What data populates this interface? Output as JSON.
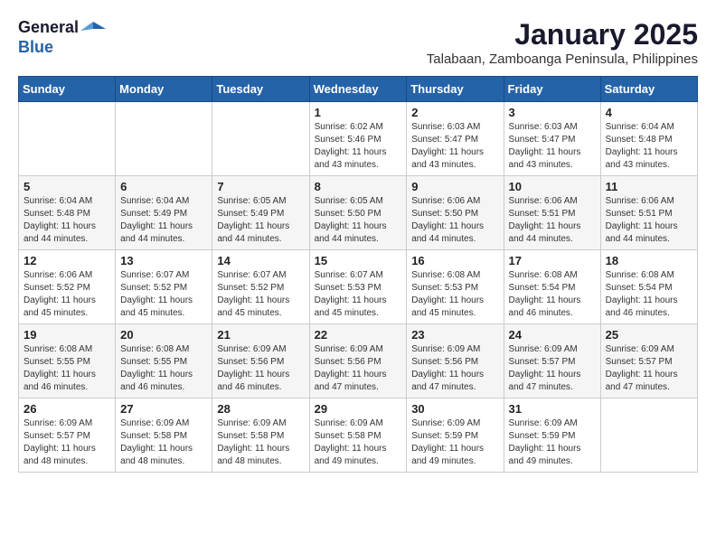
{
  "header": {
    "logo_general": "General",
    "logo_blue": "Blue",
    "month": "January 2025",
    "location": "Talabaan, Zamboanga Peninsula, Philippines"
  },
  "weekdays": [
    "Sunday",
    "Monday",
    "Tuesday",
    "Wednesday",
    "Thursday",
    "Friday",
    "Saturday"
  ],
  "weeks": [
    [
      {
        "day": "",
        "info": ""
      },
      {
        "day": "",
        "info": ""
      },
      {
        "day": "",
        "info": ""
      },
      {
        "day": "1",
        "info": "Sunrise: 6:02 AM\nSunset: 5:46 PM\nDaylight: 11 hours\nand 43 minutes."
      },
      {
        "day": "2",
        "info": "Sunrise: 6:03 AM\nSunset: 5:47 PM\nDaylight: 11 hours\nand 43 minutes."
      },
      {
        "day": "3",
        "info": "Sunrise: 6:03 AM\nSunset: 5:47 PM\nDaylight: 11 hours\nand 43 minutes."
      },
      {
        "day": "4",
        "info": "Sunrise: 6:04 AM\nSunset: 5:48 PM\nDaylight: 11 hours\nand 43 minutes."
      }
    ],
    [
      {
        "day": "5",
        "info": "Sunrise: 6:04 AM\nSunset: 5:48 PM\nDaylight: 11 hours\nand 44 minutes."
      },
      {
        "day": "6",
        "info": "Sunrise: 6:04 AM\nSunset: 5:49 PM\nDaylight: 11 hours\nand 44 minutes."
      },
      {
        "day": "7",
        "info": "Sunrise: 6:05 AM\nSunset: 5:49 PM\nDaylight: 11 hours\nand 44 minutes."
      },
      {
        "day": "8",
        "info": "Sunrise: 6:05 AM\nSunset: 5:50 PM\nDaylight: 11 hours\nand 44 minutes."
      },
      {
        "day": "9",
        "info": "Sunrise: 6:06 AM\nSunset: 5:50 PM\nDaylight: 11 hours\nand 44 minutes."
      },
      {
        "day": "10",
        "info": "Sunrise: 6:06 AM\nSunset: 5:51 PM\nDaylight: 11 hours\nand 44 minutes."
      },
      {
        "day": "11",
        "info": "Sunrise: 6:06 AM\nSunset: 5:51 PM\nDaylight: 11 hours\nand 44 minutes."
      }
    ],
    [
      {
        "day": "12",
        "info": "Sunrise: 6:06 AM\nSunset: 5:52 PM\nDaylight: 11 hours\nand 45 minutes."
      },
      {
        "day": "13",
        "info": "Sunrise: 6:07 AM\nSunset: 5:52 PM\nDaylight: 11 hours\nand 45 minutes."
      },
      {
        "day": "14",
        "info": "Sunrise: 6:07 AM\nSunset: 5:52 PM\nDaylight: 11 hours\nand 45 minutes."
      },
      {
        "day": "15",
        "info": "Sunrise: 6:07 AM\nSunset: 5:53 PM\nDaylight: 11 hours\nand 45 minutes."
      },
      {
        "day": "16",
        "info": "Sunrise: 6:08 AM\nSunset: 5:53 PM\nDaylight: 11 hours\nand 45 minutes."
      },
      {
        "day": "17",
        "info": "Sunrise: 6:08 AM\nSunset: 5:54 PM\nDaylight: 11 hours\nand 46 minutes."
      },
      {
        "day": "18",
        "info": "Sunrise: 6:08 AM\nSunset: 5:54 PM\nDaylight: 11 hours\nand 46 minutes."
      }
    ],
    [
      {
        "day": "19",
        "info": "Sunrise: 6:08 AM\nSunset: 5:55 PM\nDaylight: 11 hours\nand 46 minutes."
      },
      {
        "day": "20",
        "info": "Sunrise: 6:08 AM\nSunset: 5:55 PM\nDaylight: 11 hours\nand 46 minutes."
      },
      {
        "day": "21",
        "info": "Sunrise: 6:09 AM\nSunset: 5:56 PM\nDaylight: 11 hours\nand 46 minutes."
      },
      {
        "day": "22",
        "info": "Sunrise: 6:09 AM\nSunset: 5:56 PM\nDaylight: 11 hours\nand 47 minutes."
      },
      {
        "day": "23",
        "info": "Sunrise: 6:09 AM\nSunset: 5:56 PM\nDaylight: 11 hours\nand 47 minutes."
      },
      {
        "day": "24",
        "info": "Sunrise: 6:09 AM\nSunset: 5:57 PM\nDaylight: 11 hours\nand 47 minutes."
      },
      {
        "day": "25",
        "info": "Sunrise: 6:09 AM\nSunset: 5:57 PM\nDaylight: 11 hours\nand 47 minutes."
      }
    ],
    [
      {
        "day": "26",
        "info": "Sunrise: 6:09 AM\nSunset: 5:57 PM\nDaylight: 11 hours\nand 48 minutes."
      },
      {
        "day": "27",
        "info": "Sunrise: 6:09 AM\nSunset: 5:58 PM\nDaylight: 11 hours\nand 48 minutes."
      },
      {
        "day": "28",
        "info": "Sunrise: 6:09 AM\nSunset: 5:58 PM\nDaylight: 11 hours\nand 48 minutes."
      },
      {
        "day": "29",
        "info": "Sunrise: 6:09 AM\nSunset: 5:58 PM\nDaylight: 11 hours\nand 49 minutes."
      },
      {
        "day": "30",
        "info": "Sunrise: 6:09 AM\nSunset: 5:59 PM\nDaylight: 11 hours\nand 49 minutes."
      },
      {
        "day": "31",
        "info": "Sunrise: 6:09 AM\nSunset: 5:59 PM\nDaylight: 11 hours\nand 49 minutes."
      },
      {
        "day": "",
        "info": ""
      }
    ]
  ]
}
